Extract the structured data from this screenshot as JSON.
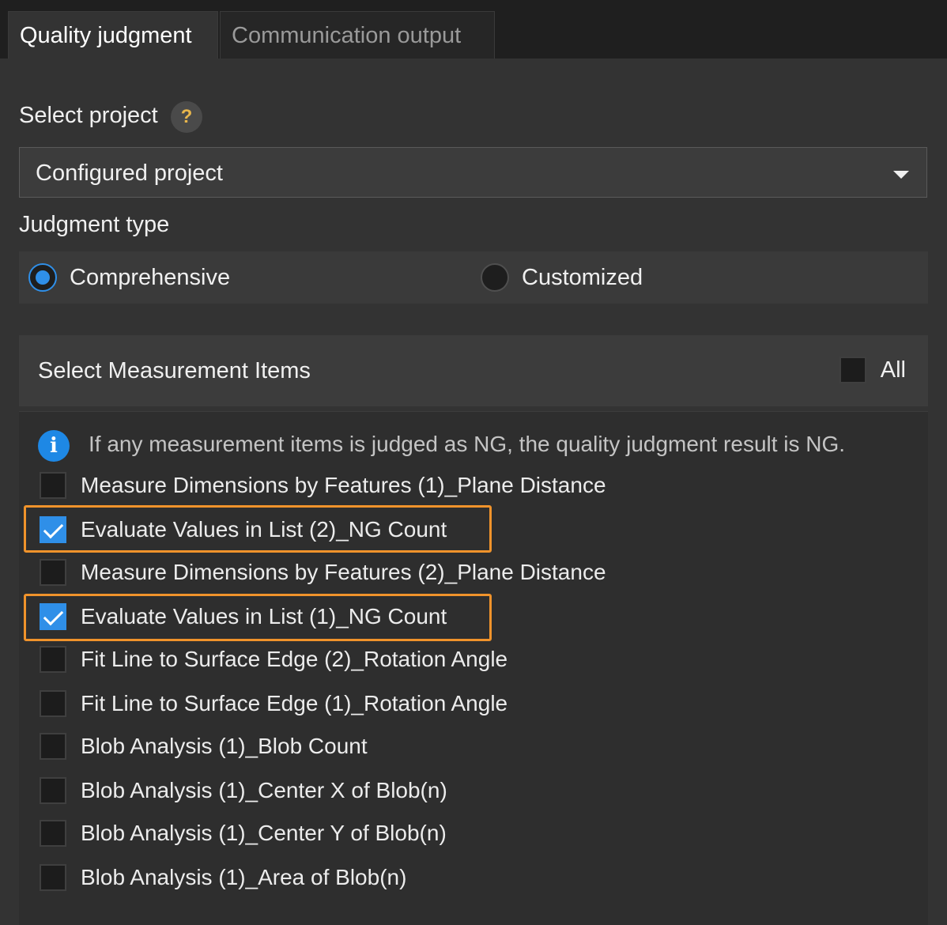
{
  "tabs": [
    {
      "label": "Quality judgment"
    },
    {
      "label": "Communication output"
    }
  ],
  "select_project": {
    "label": "Select project",
    "help_symbol": "?",
    "value": "Configured project"
  },
  "judgment_type": {
    "label": "Judgment type",
    "options": [
      {
        "label": "Comprehensive",
        "selected": true
      },
      {
        "label": "Customized",
        "selected": false
      }
    ]
  },
  "measurement": {
    "title": "Select Measurement Items",
    "all_label": "All",
    "info_symbol": "i",
    "info_text": "If any measurement items is judged as NG, the quality judgment result is NG.",
    "items": [
      {
        "label": "Measure Dimensions by Features (1)_Plane Distance",
        "checked": false
      },
      {
        "label": "Evaluate Values in List (2)_NG Count",
        "checked": true
      },
      {
        "label": "Measure Dimensions by Features (2)_Plane Distance",
        "checked": false
      },
      {
        "label": "Evaluate Values in List (1)_NG Count",
        "checked": true
      },
      {
        "label": "Fit Line to Surface Edge (2)_Rotation Angle",
        "checked": false
      },
      {
        "label": "Fit Line to Surface Edge (1)_Rotation Angle",
        "checked": false
      },
      {
        "label": "Blob Analysis (1)_Blob Count",
        "checked": false
      },
      {
        "label": "Blob Analysis (1)_Center X of Blob(n)",
        "checked": false
      },
      {
        "label": "Blob Analysis (1)_Center Y of Blob(n)",
        "checked": false
      },
      {
        "label": "Blob Analysis (1)_Area of Blob(n)",
        "checked": false
      }
    ]
  },
  "colors": {
    "accent": "#2f8fe8",
    "highlight_border": "#f0932b",
    "background": "#333333"
  }
}
